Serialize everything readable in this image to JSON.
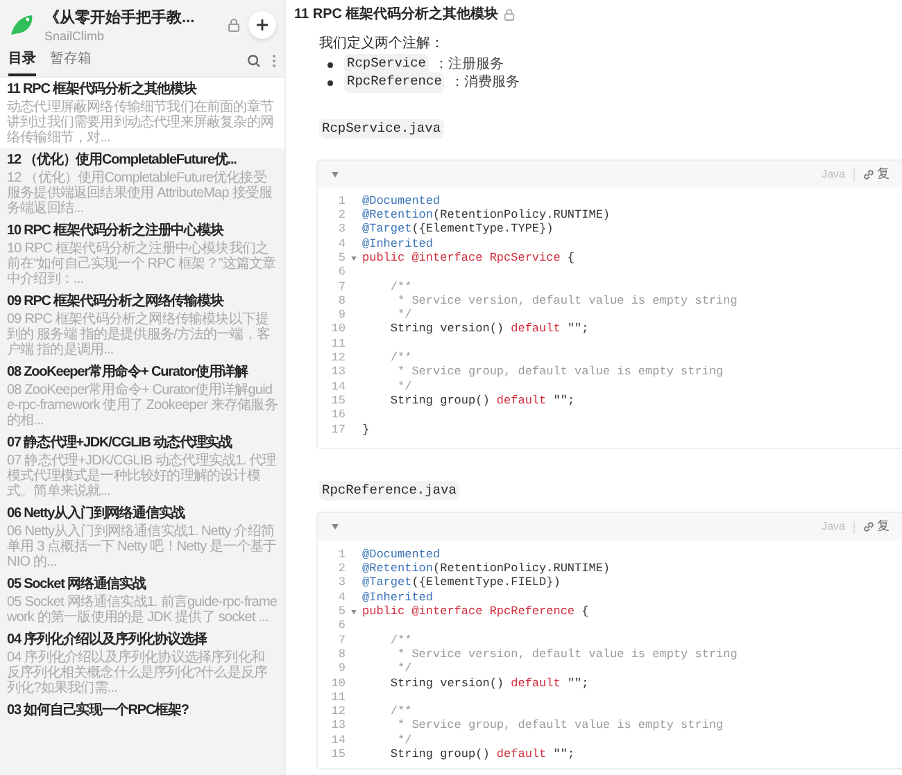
{
  "book": {
    "title": "《从零开始手把手教...",
    "author": "SnailClimb"
  },
  "tabs": [
    {
      "label": "目录",
      "selected": true
    },
    {
      "label": "暂存箱",
      "selected": false
    }
  ],
  "toc": {
    "items": [
      {
        "title": "11 RPC 框架代码分析之其他模块",
        "excerpt": "动态代理屏蔽网络传输细节我们在前面的章节讲到过我们需要用到动态代理来屏蔽复杂的网络传输细节，对...",
        "selected": true
      },
      {
        "title": "12 （优化）使用CompletableFuture优...",
        "excerpt": "12 （优化）使用CompletableFuture优化接受服务提供端返回结果使用 AttributeMap 接受服务端返回结...",
        "selected": false
      },
      {
        "title": "10 RPC 框架代码分析之注册中心模块",
        "excerpt": "10 RPC 框架代码分析之注册中心模块我们之前在“如何自己实现一个 RPC 框架？”这篇文章中介绍到：...",
        "selected": false
      },
      {
        "title": "09 RPC 框架代码分析之网络传输模块",
        "excerpt": "09 RPC 框架代码分析之网络传输模块以下提到的 服务端 指的是提供服务/方法的一端，客户端 指的是调用...",
        "selected": false
      },
      {
        "title": "08 ZooKeeper常用命令+ Curator使用详解",
        "excerpt": "08 ZooKeeper常用命令+ Curator使用详解guide-rpc-framework 使用了 Zookeeper 来存储服务的相...",
        "selected": false
      },
      {
        "title": "07 静态代理+JDK/CGLIB 动态代理实战",
        "excerpt": "07 静态代理+JDK/CGLIB 动态代理实战1. 代理模式代理模式是一种比较好的理解的设计模式。简单来说就...",
        "selected": false
      },
      {
        "title": "06 Netty从入门到网络通信实战",
        "excerpt": "06 Netty从入门到网络通信实战1. Netty 介绍简单用 3 点概括一下 Netty 吧！Netty 是一个基于 NIO 的...",
        "selected": false
      },
      {
        "title": "05 Socket 网络通信实战",
        "excerpt": "05 Socket 网络通信实战1. 前言guide-rpc-framework 的第一版使用的是 JDK 提供了 socket ...",
        "selected": false
      },
      {
        "title": "04 序列化介绍以及序列化协议选择",
        "excerpt": "04 序列化介绍以及序列化协议选择序列化和反序列化相关概念什么是序列化?什么是反序列化?如果我们需...",
        "selected": false
      },
      {
        "title": "03 如何自己实现一个RPC框架?",
        "selected": false
      }
    ]
  },
  "article": {
    "title": "11 RPC 框架代码分析之其他模块",
    "intro": "我们定义两个注解：",
    "bullets": [
      {
        "code": "RcpService",
        "text": "：注册服务"
      },
      {
        "code": "RpcReference",
        "text": "：消费服务"
      }
    ],
    "blocks": [
      {
        "filename": "RcpService.java",
        "language": "Java",
        "copy": "复",
        "lines": [
          {
            "number": "1",
            "fold": false,
            "segments": [
              {
                "kind": "annotation",
                "text": "@Documented"
              }
            ]
          },
          {
            "number": "2",
            "fold": false,
            "segments": [
              {
                "kind": "annotation",
                "text": "@Retention"
              },
              {
                "kind": "plain",
                "text": "(RetentionPolicy.RUNTIME)"
              }
            ]
          },
          {
            "number": "3",
            "fold": false,
            "segments": [
              {
                "kind": "annotation",
                "text": "@Target"
              },
              {
                "kind": "plain",
                "text": "({ElementType.TYPE})"
              }
            ]
          },
          {
            "number": "4",
            "fold": false,
            "segments": [
              {
                "kind": "annotation",
                "text": "@Inherited"
              }
            ]
          },
          {
            "number": "5",
            "fold": true,
            "segments": [
              {
                "kind": "keyword",
                "text": "public @interface RpcService"
              },
              {
                "kind": "plain",
                "text": " {"
              }
            ]
          },
          {
            "number": "6",
            "fold": false
          },
          {
            "number": "7",
            "fold": false,
            "segments": [
              {
                "kind": "comment",
                "text": "    /**"
              }
            ]
          },
          {
            "number": "8",
            "fold": false,
            "segments": [
              {
                "kind": "comment",
                "text": "     * Service version, default value is empty string"
              }
            ]
          },
          {
            "number": "9",
            "fold": false,
            "segments": [
              {
                "kind": "comment",
                "text": "     */"
              }
            ]
          },
          {
            "number": "10",
            "fold": false,
            "segments": [
              {
                "kind": "plain",
                "text": "    String version() "
              },
              {
                "kind": "keyword",
                "text": "default"
              },
              {
                "kind": "plain",
                "text": " \"\";"
              }
            ]
          },
          {
            "number": "11",
            "fold": false
          },
          {
            "number": "12",
            "fold": false,
            "segments": [
              {
                "kind": "comment",
                "text": "    /**"
              }
            ]
          },
          {
            "number": "13",
            "fold": false,
            "segments": [
              {
                "kind": "comment",
                "text": "     * Service group, default value is empty string"
              }
            ]
          },
          {
            "number": "14",
            "fold": false,
            "segments": [
              {
                "kind": "comment",
                "text": "     */"
              }
            ]
          },
          {
            "number": "15",
            "fold": false,
            "segments": [
              {
                "kind": "plain",
                "text": "    String group() "
              },
              {
                "kind": "keyword",
                "text": "default"
              },
              {
                "kind": "plain",
                "text": " \"\";"
              }
            ]
          },
          {
            "number": "16",
            "fold": false
          },
          {
            "number": "17",
            "fold": false,
            "segments": [
              {
                "kind": "plain",
                "text": "}"
              }
            ]
          }
        ]
      },
      {
        "filename": "RpcReference.java",
        "language": "Java",
        "copy": "复",
        "lines": [
          {
            "number": "1",
            "fold": false,
            "segments": [
              {
                "kind": "annotation",
                "text": "@Documented"
              }
            ]
          },
          {
            "number": "2",
            "fold": false,
            "segments": [
              {
                "kind": "annotation",
                "text": "@Retention"
              },
              {
                "kind": "plain",
                "text": "(RetentionPolicy.RUNTIME)"
              }
            ]
          },
          {
            "number": "3",
            "fold": false,
            "segments": [
              {
                "kind": "annotation",
                "text": "@Target"
              },
              {
                "kind": "plain",
                "text": "({ElementType.FIELD})"
              }
            ]
          },
          {
            "number": "4",
            "fold": false,
            "segments": [
              {
                "kind": "annotation",
                "text": "@Inherited"
              }
            ]
          },
          {
            "number": "5",
            "fold": true,
            "segments": [
              {
                "kind": "keyword",
                "text": "public @interface RpcReference"
              },
              {
                "kind": "plain",
                "text": " {"
              }
            ]
          },
          {
            "number": "6",
            "fold": false
          },
          {
            "number": "7",
            "fold": false,
            "segments": [
              {
                "kind": "comment",
                "text": "    /**"
              }
            ]
          },
          {
            "number": "8",
            "fold": false,
            "segments": [
              {
                "kind": "comment",
                "text": "     * Service version, default value is empty string"
              }
            ]
          },
          {
            "number": "9",
            "fold": false,
            "segments": [
              {
                "kind": "comment",
                "text": "     */"
              }
            ]
          },
          {
            "number": "10",
            "fold": false,
            "segments": [
              {
                "kind": "plain",
                "text": "    String version() "
              },
              {
                "kind": "keyword",
                "text": "default"
              },
              {
                "kind": "plain",
                "text": " \"\";"
              }
            ]
          },
          {
            "number": "11",
            "fold": false
          },
          {
            "number": "12",
            "fold": false,
            "segments": [
              {
                "kind": "comment",
                "text": "    /**"
              }
            ]
          },
          {
            "number": "13",
            "fold": false,
            "segments": [
              {
                "kind": "comment",
                "text": "     * Service group, default value is empty string"
              }
            ]
          },
          {
            "number": "14",
            "fold": false,
            "segments": [
              {
                "kind": "comment",
                "text": "     */"
              }
            ]
          },
          {
            "number": "15",
            "fold": false,
            "segments": [
              {
                "kind": "plain",
                "text": "    String group() "
              },
              {
                "kind": "keyword",
                "text": "default"
              },
              {
                "kind": "plain",
                "text": " \"\";"
              }
            ]
          }
        ]
      }
    ]
  }
}
